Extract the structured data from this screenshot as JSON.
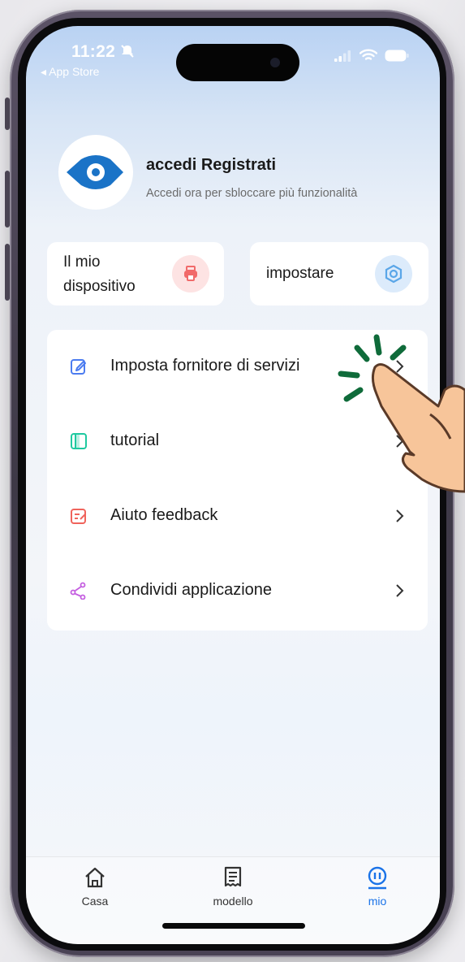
{
  "status": {
    "time": "11:22",
    "back_label": "◂ App Store"
  },
  "profile": {
    "name": "accedi Registrati",
    "subtitle": "Accedi ora per sbloccare più funzionalità"
  },
  "quick_actions": [
    {
      "label": "Il mio dispositivo",
      "icon": "printer-icon",
      "color": "#f16a6a"
    },
    {
      "label": "impostare",
      "icon": "hexagon-settings-icon",
      "color": "#5aa6e8"
    }
  ],
  "menu": [
    {
      "label": "Imposta fornitore di servizi",
      "icon": "edit-icon",
      "color": "#4c7cf0"
    },
    {
      "label": "tutorial",
      "icon": "book-icon",
      "color": "#1fc9a0"
    },
    {
      "label": "Aiuto feedback",
      "icon": "feedback-icon",
      "color": "#f0645c"
    },
    {
      "label": "Condividi applicazione",
      "icon": "share-icon",
      "color": "#c45ee0"
    }
  ],
  "tabs": [
    {
      "label": "Casa",
      "icon": "home-icon",
      "active": false
    },
    {
      "label": "modello",
      "icon": "receipt-icon",
      "active": false
    },
    {
      "label": "mio",
      "icon": "profile-icon",
      "active": true
    }
  ],
  "accent_color": "#1a73e8"
}
